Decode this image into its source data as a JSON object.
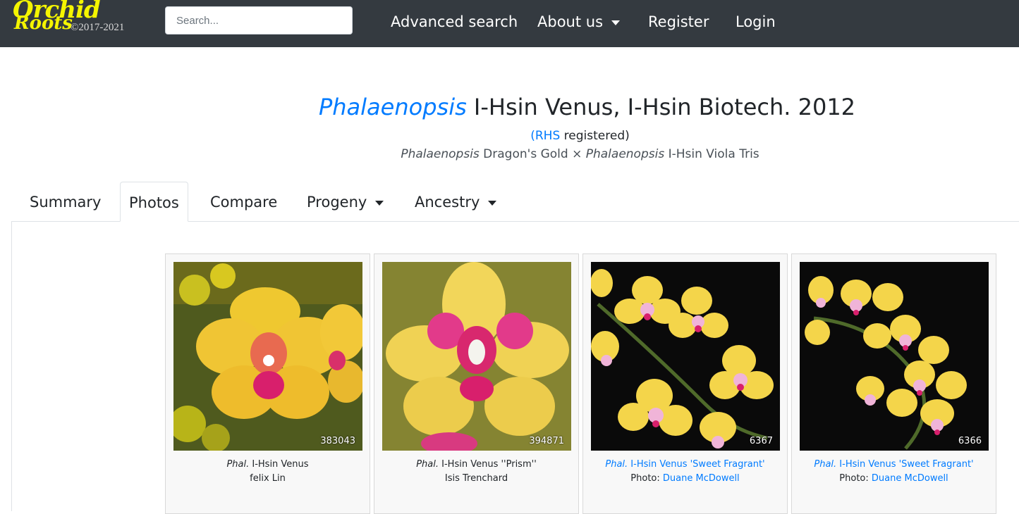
{
  "navbar": {
    "logo_top": "Orchid",
    "logo_bottom": "Roots",
    "logo_copyright": "©2017-2021",
    "search_placeholder": "Search...",
    "links": {
      "advanced_search": "Advanced search",
      "about_us": "About us",
      "register": "Register",
      "login": "Login"
    }
  },
  "header": {
    "genus": "Phalaenopsis",
    "title_rest": "I-Hsin Venus, I-Hsin Biotech. 2012",
    "reg_open": "(",
    "reg_link": "RHS",
    "reg_rest": " registered)",
    "parent1_genus": "Phalaenopsis",
    "parent1_name": " Dragon's Gold × ",
    "parent2_genus": "Phalaenopsis",
    "parent2_name": " I-Hsin Viola Tris"
  },
  "tabs": {
    "summary": "Summary",
    "photos": "Photos",
    "compare": "Compare",
    "progeny": "Progeny",
    "ancestry": "Ancestry",
    "active": "Photos"
  },
  "photos": [
    {
      "id": "383043",
      "abbr": "Phal.",
      "name": " I-Hsin Venus",
      "credit_label": "",
      "credit": "felix Lin",
      "linked": false
    },
    {
      "id": "394871",
      "abbr": "Phal.",
      "name": " I-Hsin Venus ''Prism''",
      "credit_label": "",
      "credit": "Isis Trenchard",
      "linked": false
    },
    {
      "id": "6367",
      "abbr": "Phal.",
      "name": " I-Hsin Venus 'Sweet Fragrant'",
      "credit_label": "Photo: ",
      "credit": "Duane McDowell",
      "linked": true
    },
    {
      "id": "6366",
      "abbr": "Phal.",
      "name": " I-Hsin Venus 'Sweet Fragrant'",
      "credit_label": "Photo: ",
      "credit": "Duane McDowell",
      "linked": true
    }
  ],
  "colors": {
    "navbar_bg": "#343a40",
    "logo_yellow": "#f5f500",
    "link_blue": "#007bff",
    "petal_yellow": "#f2d83a",
    "lip_magenta": "#d81f6c"
  }
}
